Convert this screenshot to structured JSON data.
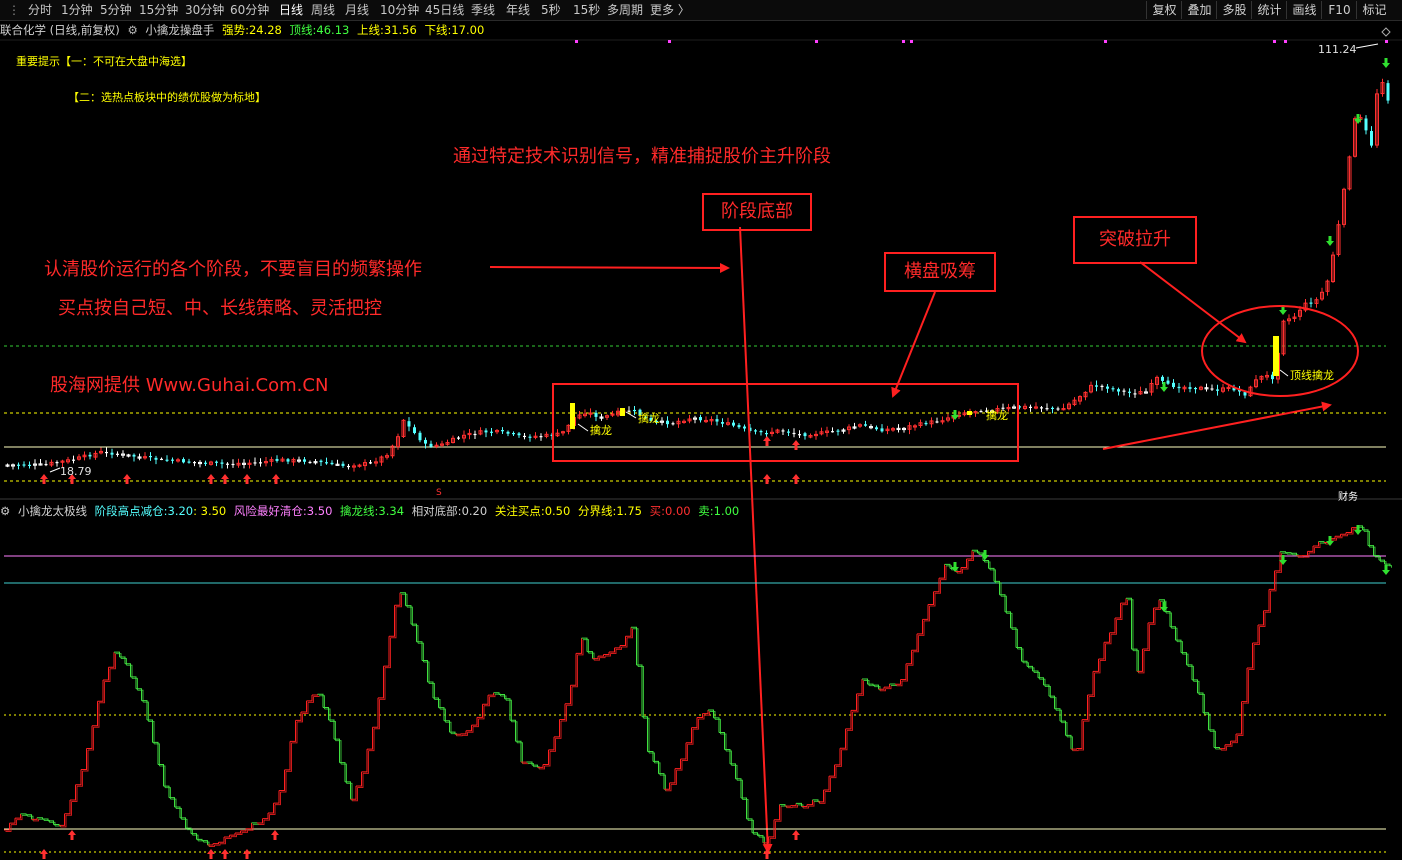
{
  "toolbar": {
    "periods": [
      "分时",
      "1分钟",
      "5分钟",
      "15分钟",
      "30分钟",
      "60分钟",
      "日线",
      "周线",
      "月线",
      "10分钟",
      "45日线",
      "季线",
      "年线",
      "5秒",
      "15秒",
      "多周期",
      "更多 〉"
    ],
    "active_period": "日线",
    "tools": [
      "复权",
      "叠加",
      "多股",
      "统计",
      "画线",
      "F10",
      "标记"
    ]
  },
  "main_info": {
    "stock": "联合化学 (日线,前复权)",
    "indicator": "小擒龙操盘手",
    "qiangshi_label": "强势:",
    "qiangshi_value": "24.28",
    "dingxian_label": "顶线:",
    "dingxian_value": "46.13",
    "shangxian_label": "上线:",
    "shangxian_value": "31.56",
    "xiaxian_label": "下线:",
    "xiaxian_value": "17.00"
  },
  "tips": {
    "line1": "重要提示【一：不可在大盘中海选】",
    "line2": "【二：选热点板块中的绩优股做为标地】"
  },
  "annotations": {
    "headline": "通过特定技术识别信号，精准捕捉股价主升阶段",
    "stages": "认清股价运行的各个阶段，不要盲目的频繁操作",
    "strategy": "买点按自己短、中、长线策略、灵活把控",
    "provider": "股海网提供 Www.Guhai.Com.CN",
    "box_bottom": "阶段底部",
    "box_sideways": "横盘吸筹",
    "box_breakout": "突破拉升"
  },
  "price_labels": {
    "high": "111.24",
    "low": "18.79",
    "qinlong1": "擒龙",
    "qinlong2": "擒龙",
    "qinlong3": "擒龙",
    "dingxian_qinlong": "顶线擒龙",
    "s_marker": "S",
    "cai_marker": "财务"
  },
  "sub_info": {
    "name": "小擒龙太极线",
    "l1": "阶段高点减仓:",
    "v1": "3.20",
    "v1b": ": 3.50",
    "l2": "风险最好清仓:",
    "v2": "3.50",
    "l3": "擒龙线:",
    "v3": "3.34",
    "l4": "相对底部:",
    "v4": "0.20",
    "l5": "关注买点:",
    "v5": "0.50",
    "l6": "分界线:",
    "v6": "1.75",
    "l7": "买:",
    "v7": "0.00",
    "l8": "卖:",
    "v8": "1.00"
  },
  "colors": {
    "up": "#ff3030",
    "down": "#54ffff",
    "flat": "#ffffff",
    "yellow": "#ffff00",
    "taiji_up": "#ff2020",
    "taiji_down": "#40e040",
    "annotation": "#ff2a2a"
  }
}
